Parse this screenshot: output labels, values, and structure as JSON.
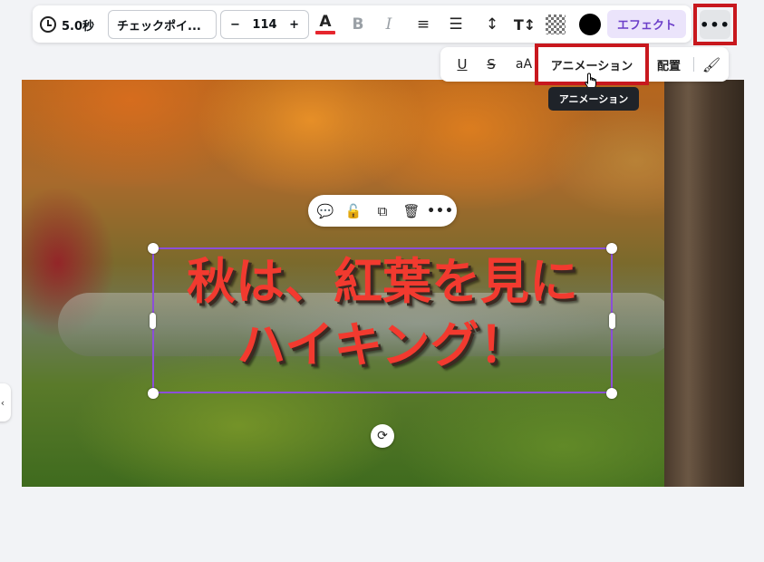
{
  "toolbar": {
    "duration": "5.0秒",
    "font_name": "チェックポイ...",
    "font_size": "114",
    "decrease": "−",
    "increase": "+",
    "font_color_letter": "A",
    "bold": "B",
    "italic": "I",
    "align_glyph": "≡",
    "list_glyph": "☰",
    "spacing_glyph": "↕",
    "textsize_glyph": "T↕",
    "color_swatch": "#000000",
    "effects_label": "エフェクト",
    "more_glyph": "•••"
  },
  "subtoolbar": {
    "underline": "U",
    "strikethrough": "S",
    "case": "aA",
    "animate_label": "アニメーション",
    "arrange_label": "配置",
    "paint_glyph": "🖌"
  },
  "tooltip": {
    "text": "アニメーション"
  },
  "element_toolbar": {
    "comment_glyph": "💬",
    "lock_glyph": "🔓",
    "copy_glyph": "⧉",
    "delete_glyph": "🗑",
    "more_glyph": "•••"
  },
  "canvas": {
    "headline_line1": "秋は、紅葉を見に",
    "headline_line2": "ハイキング！",
    "rotate_glyph": "⟳",
    "headline_color": "#f23a2f",
    "selection_color": "#8b4fd8"
  },
  "side_tab_glyph": "‹",
  "highlight_color": "#c8181e"
}
